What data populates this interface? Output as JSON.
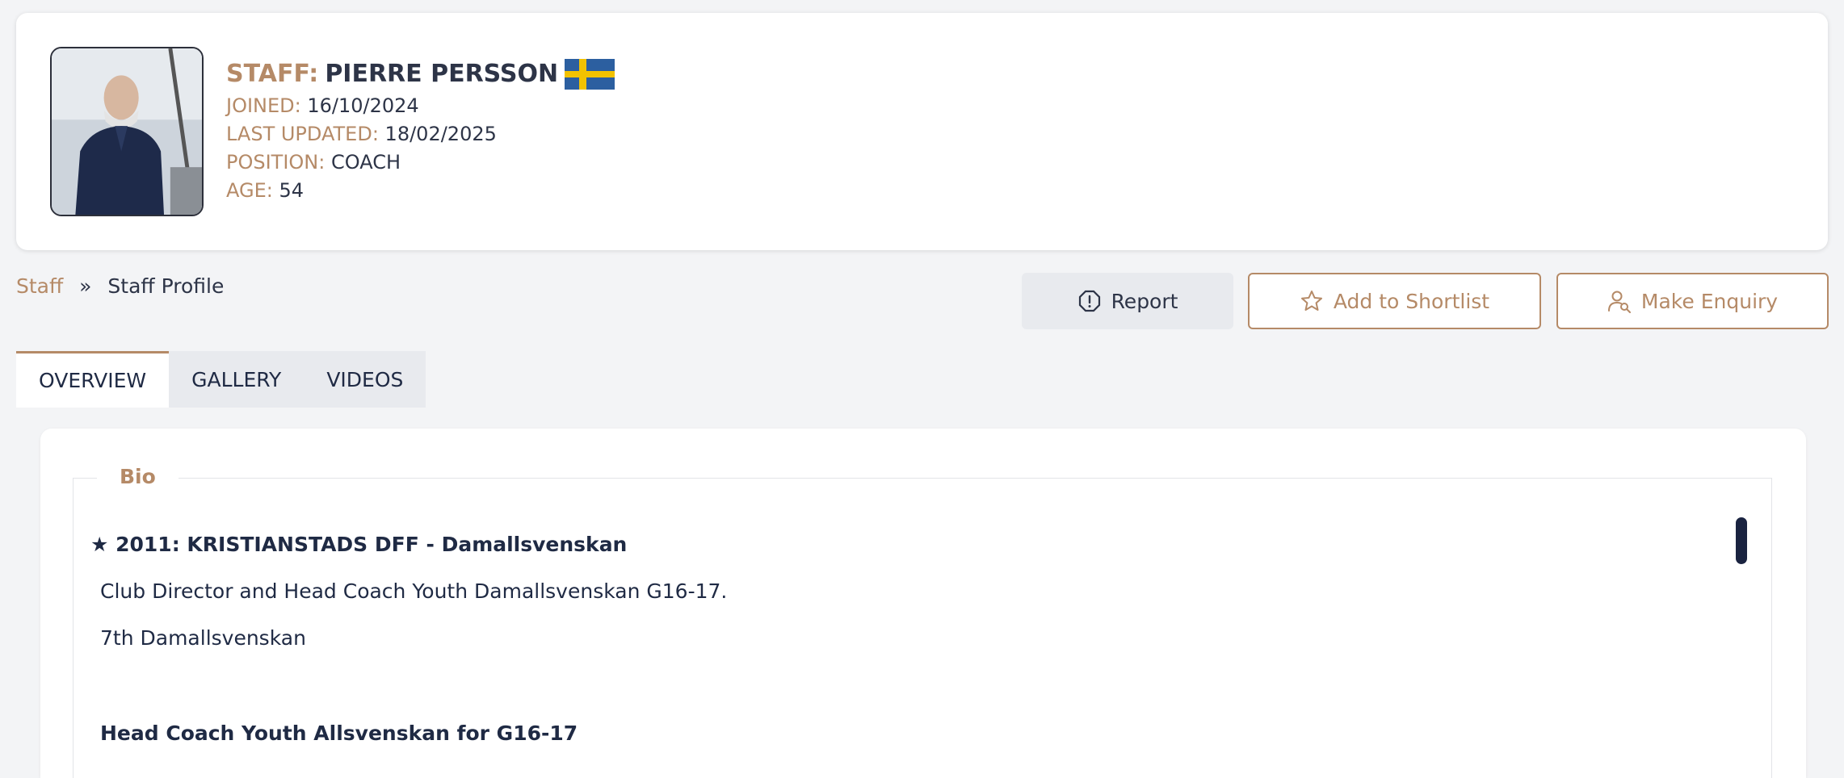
{
  "profile": {
    "title_label": "STAFF:",
    "name": "PIERRE PERSSON",
    "flag_icon": "sweden-flag-icon",
    "joined_label": "JOINED:",
    "joined": "16/10/2024",
    "updated_label": "LAST UPDATED:",
    "updated": "18/02/2025",
    "position_label": "POSITION:",
    "position": "COACH",
    "age_label": "AGE:",
    "age": "54"
  },
  "breadcrumb": {
    "parent": "Staff",
    "separator": "»",
    "current": "Staff Profile"
  },
  "actions": {
    "report": "Report",
    "shortlist": "Add to Shortlist",
    "enquiry": "Make Enquiry"
  },
  "tabs": [
    {
      "label": "OVERVIEW"
    },
    {
      "label": "GALLERY"
    },
    {
      "label": "VIDEOS"
    }
  ],
  "bio": {
    "legend": "Bio",
    "entry_heading": "★ 2011: KRISTIANSTADS DFF - Damallsvenskan",
    "line1": "Club Director and Head Coach Youth Damallsvenskan G16-17.",
    "line2": "7th Damallsvenskan",
    "subheading": "Head Coach Youth Allsvenskan for G16-17"
  },
  "colors": {
    "accent": "#b58a67",
    "text": "#1f2a44",
    "background": "#f3f4f6"
  }
}
